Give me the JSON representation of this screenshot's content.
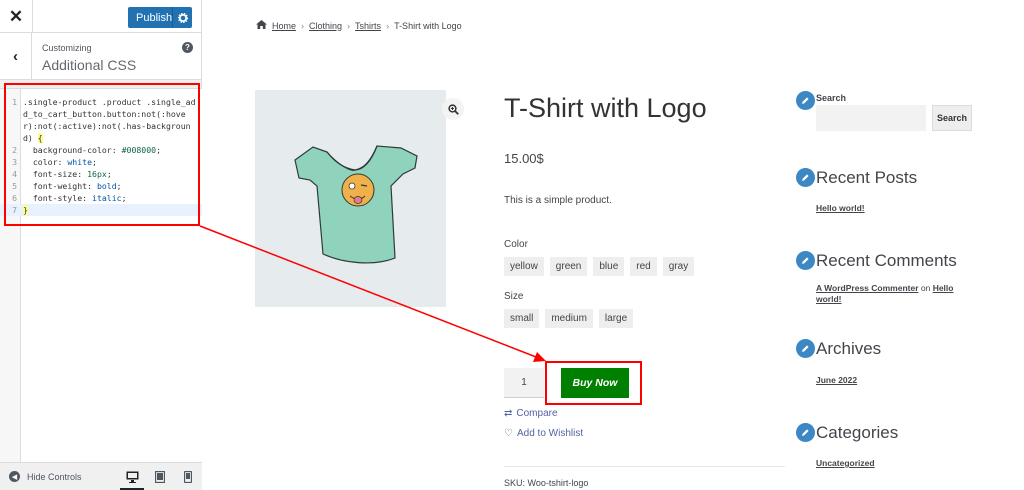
{
  "customizer": {
    "publish_label": "Publish",
    "header_sub": "Customizing",
    "header_title": "Additional CSS",
    "help_glyph": "?",
    "footer": {
      "hide_controls": "Hide Controls"
    }
  },
  "css_code": {
    "line_numbers": [
      "1",
      "2",
      "3",
      "4",
      "5",
      "6",
      "7"
    ],
    "line1_a": ".single-product .product .single_add_to_cart_button.button:not(:hover):not(:active):not(.has-background) ",
    "line1_b": "{",
    "line2_prop": "  background-color: ",
    "line2_val": "#008000",
    "line2_end": ";",
    "line3_prop": "  color: ",
    "line3_val": "white",
    "line3_end": ";",
    "line4_prop": "  font-size: ",
    "line4_val": "16px",
    "line4_end": ";",
    "line5_prop": "  font-weight: ",
    "line5_val": "bold",
    "line5_end": ";",
    "line6_prop": "  font-style: ",
    "line6_val": "italic",
    "line6_end": ";",
    "line7": "}"
  },
  "breadcrumb": {
    "home": "Home",
    "sep": "›",
    "clothing": "Clothing",
    "tshirts": "Tshirts",
    "current": "T-Shirt with Logo"
  },
  "product": {
    "title": "T-Shirt with Logo",
    "price": "15.00$",
    "description": "This is a simple product.",
    "color_label": "Color",
    "colors": [
      "yellow",
      "green",
      "blue",
      "red",
      "gray"
    ],
    "size_label": "Size",
    "sizes": [
      "small",
      "medium",
      "large"
    ],
    "quantity": "1",
    "buy_label": "Buy Now",
    "compare_label": "Compare",
    "wishlist_label": "Add to Wishlist",
    "sku": "SKU: Woo-tshirt-logo"
  },
  "sidebar": {
    "search_title": "Search",
    "search_button": "Search",
    "recent_posts_title": "Recent Posts",
    "recent_posts": [
      "Hello world!"
    ],
    "recent_comments_title": "Recent Comments",
    "comment_author": "A WordPress Commenter",
    "comment_on": " on ",
    "comment_post": "Hello world!",
    "archives_title": "Archives",
    "archives": [
      "June 2022"
    ],
    "categories_title": "Categories",
    "categories": [
      "Uncategorized"
    ]
  },
  "colors": {
    "accent": "#2271b1",
    "buy_button": "#008000",
    "annotation": "#ff0000",
    "widget_icon": "#3c87c4",
    "link": "#5462a3"
  },
  "icons": [
    "close-icon",
    "gear-icon",
    "back-chevron-icon",
    "help-icon",
    "home-icon",
    "zoom-icon",
    "compare-icon",
    "heart-icon",
    "pencil-icon",
    "desktop-icon",
    "tablet-icon",
    "mobile-icon"
  ]
}
